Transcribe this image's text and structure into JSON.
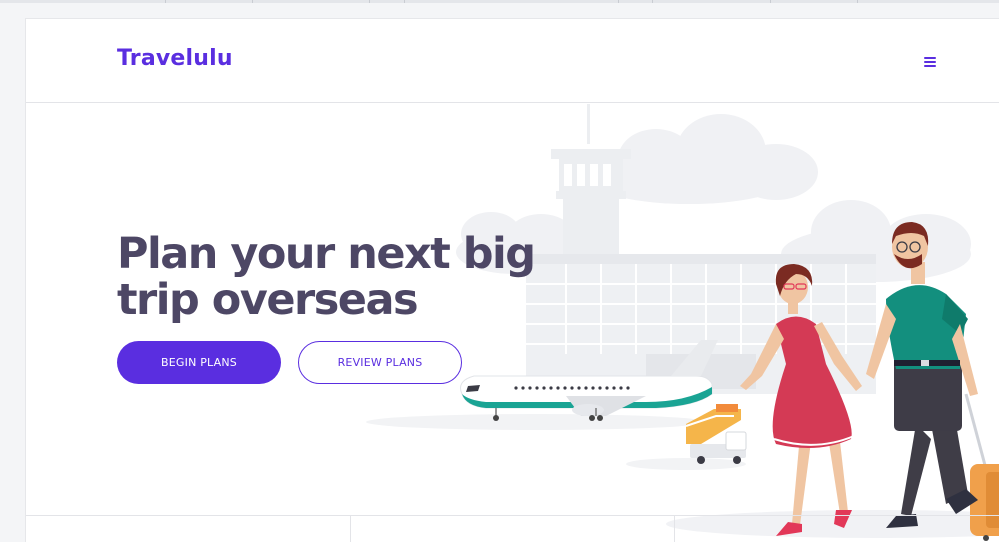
{
  "brand": {
    "name": "Travelulu",
    "accent_color": "#5a2ee0",
    "headline_color": "#4d4765"
  },
  "header": {
    "menu_icon": "hamburger-menu-icon"
  },
  "hero": {
    "headline": "Plan your next big trip overseas",
    "primary_button": "BEGIN PLANS",
    "secondary_button": "REVIEW PLANS",
    "illustration": "airport-couple-travel-illustration"
  }
}
